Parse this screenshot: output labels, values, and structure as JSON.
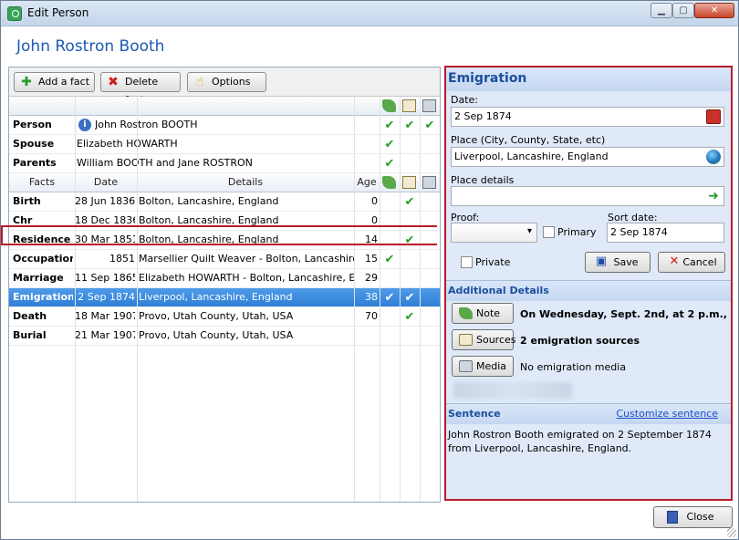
{
  "window": {
    "title": "Edit Person"
  },
  "person_name": "John Rostron Booth",
  "toolbar": {
    "add_label": "Add a fact",
    "delete_label": "Delete fact",
    "options_label": "Options"
  },
  "family": [
    {
      "label": "Person",
      "value": "John Rostron BOOTH",
      "checks": [
        true,
        true,
        true
      ]
    },
    {
      "label": "Spouse",
      "value": "Elizabeth HOWARTH",
      "checks": [
        true,
        false,
        false
      ]
    },
    {
      "label": "Parents",
      "value": "William BOOTH and Jane ROSTRON",
      "checks": [
        true,
        false,
        false
      ]
    }
  ],
  "facts_header": {
    "facts": "Facts",
    "date": "Date",
    "details": "Details",
    "age": "Age"
  },
  "facts": [
    {
      "fact": "Birth",
      "date": "28 Jun 1836",
      "details": "Bolton, Lancashire, England",
      "age": "0",
      "checks": [
        false,
        true,
        false
      ]
    },
    {
      "fact": "Chr",
      "date": "18 Dec 1836",
      "details": "Bolton, Lancashire, England",
      "age": "0",
      "checks": [
        false,
        false,
        false
      ]
    },
    {
      "fact": "Residence",
      "date": "30 Mar 1851",
      "details": "Bolton, Lancashire, England",
      "age": "14",
      "checks": [
        false,
        true,
        false
      ]
    },
    {
      "fact": "Occupation",
      "date": "1851",
      "details": "Marsellier Quilt Weaver - Bolton, Lancashire, ...",
      "age": "15",
      "checks": [
        true,
        false,
        false
      ]
    },
    {
      "fact": "Marriage",
      "date": "11 Sep 1865",
      "details": "Elizabeth HOWARTH - Bolton, Lancashire, En...",
      "age": "29",
      "checks": [
        false,
        false,
        false
      ]
    },
    {
      "fact": "Emigration",
      "date": "2 Sep 1874",
      "details": "Liverpool, Lancashire, England",
      "age": "38",
      "checks": [
        true,
        true,
        false
      ]
    },
    {
      "fact": "Death",
      "date": "18 Mar 1907",
      "details": "Provo, Utah County, Utah, USA",
      "age": "70",
      "checks": [
        false,
        true,
        false
      ]
    },
    {
      "fact": "Burial",
      "date": "21 Mar 1907",
      "details": "Provo, Utah County, Utah, USA",
      "age": "",
      "checks": [
        false,
        false,
        false
      ]
    }
  ],
  "check_mark": "✔",
  "editor": {
    "title": "Emigration",
    "date_label": "Date:",
    "date_value": "2 Sep 1874",
    "place_label": "Place (City, County, State, etc)",
    "place_value": "Liverpool, Lancashire, England",
    "place_details_label": "Place details",
    "place_details_value": "",
    "proof_label": "Proof:",
    "proof_value": "",
    "primary_label": "Primary",
    "sort_date_label": "Sort date:",
    "sort_date_value": "2 Sep 1874",
    "private_label": "Private",
    "save_label": "Save",
    "cancel_label": "Cancel"
  },
  "additional": {
    "title": "Additional Details",
    "note_button": "Note",
    "note_text": "On Wednesday, Sept. 2nd, at 2 p.m., the",
    "sources_button": "Sources",
    "sources_text": "2 emigration sources",
    "media_button": "Media",
    "media_text": "No emigration media"
  },
  "sentence": {
    "title": "Sentence",
    "customize_link": "Customize sentence",
    "text": "John Rostron Booth emigrated on 2 September 1874 from Liverpool, Lancashire, England."
  },
  "footer": {
    "close_label": "Close"
  },
  "colors": {
    "selection": "#3385dc",
    "accent_border": "#b81b2a",
    "title_blue": "#1c5ab3"
  }
}
